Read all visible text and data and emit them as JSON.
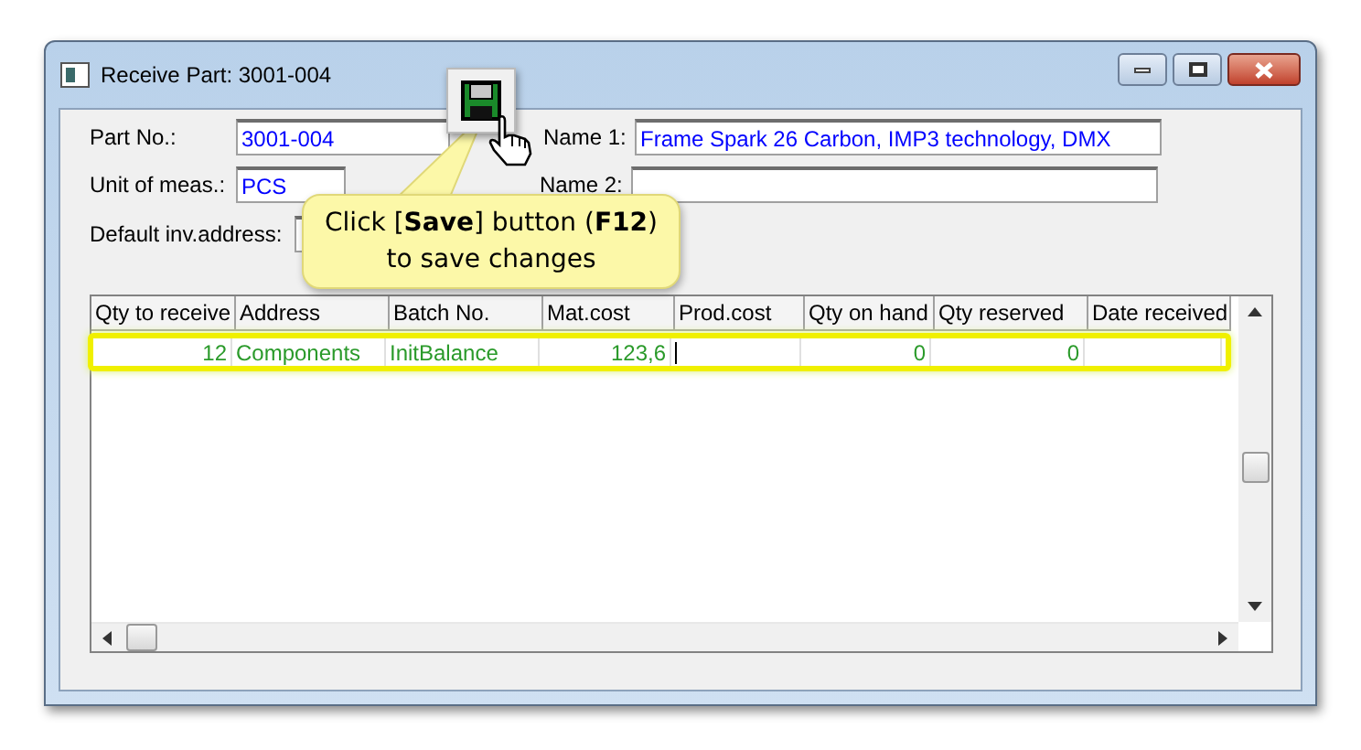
{
  "window": {
    "title": "Receive Part: 3001-004"
  },
  "fields": [
    {
      "label": "Part No.:",
      "value": "3001-004"
    },
    {
      "label": "Name 1:",
      "value": "Frame Spark 26 Carbon, IMP3 technology, DMX"
    },
    {
      "label": "Unit of meas.:",
      "value": "PCS"
    },
    {
      "label": "Name 2:"
    },
    {
      "label": "Default inv.address:"
    }
  ],
  "table": {
    "columns": [
      "Qty to receive",
      "Address",
      "Batch No.",
      "Mat.cost",
      "Prod.cost",
      "Qty on hand",
      "Qty reserved",
      "Date received"
    ],
    "rows": [
      {
        "selected": true,
        "cells": [
          "12",
          "Components",
          "InitBalance",
          "123,6",
          "",
          "0",
          "0",
          ""
        ]
      }
    ]
  },
  "callout": {
    "text": "Click [**Save**] button (**F12**)",
    "text2": "to save changes"
  }
}
